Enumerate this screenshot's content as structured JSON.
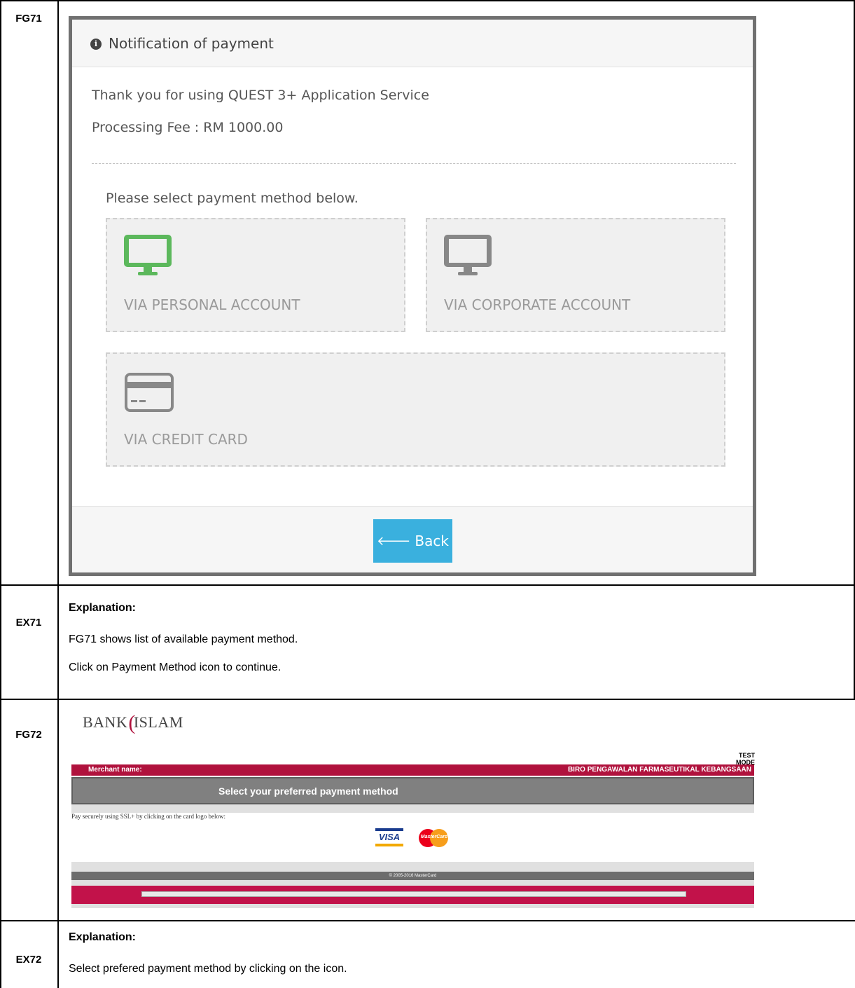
{
  "rows": {
    "fg71": "FG71",
    "ex71": "EX71",
    "fg72": "FG72",
    "ex72": "EX72"
  },
  "fg71": {
    "title": "Notification of payment",
    "thank_you": "Thank you for using QUEST 3+ Application Service",
    "processing_fee": "Processing Fee : RM 1000.00",
    "select_prompt": "Please select payment method below.",
    "methods": [
      {
        "label": "VIA PERSONAL ACCOUNT",
        "icon": "monitor-icon",
        "color": "#5cb85c"
      },
      {
        "label": "VIA CORPORATE ACCOUNT",
        "icon": "monitor-icon",
        "color": "#888888"
      },
      {
        "label": "VIA CREDIT CARD",
        "icon": "credit-card-icon",
        "color": "#888888"
      }
    ],
    "back_label": "Back",
    "back_color": "#3ab0de"
  },
  "ex71": {
    "heading": "Explanation:",
    "line1": "FG71 shows list of available payment method.",
    "line2": "Click on Payment Method icon to continue."
  },
  "fg72": {
    "logo_left": "BANK",
    "logo_right": "ISLAM",
    "test_mode": "TEST MODE",
    "merchant_label": "Merchant name:",
    "merchant_value": "BIRO PENGAWALAN FARMASEUTIKAL KEBANGSAAN",
    "select_heading": "Select your preferred payment method",
    "ssl_text": "Pay securely using SSL+ by clicking on the card logo below:",
    "visa_label": "VISA",
    "mastercard_label": "MasterCard",
    "copyright": "© 2005-2016 MasterCard",
    "brand_color": "#b0123d"
  },
  "ex72": {
    "heading": "Explanation:",
    "line1": "Select prefered payment method by clicking on the icon."
  }
}
